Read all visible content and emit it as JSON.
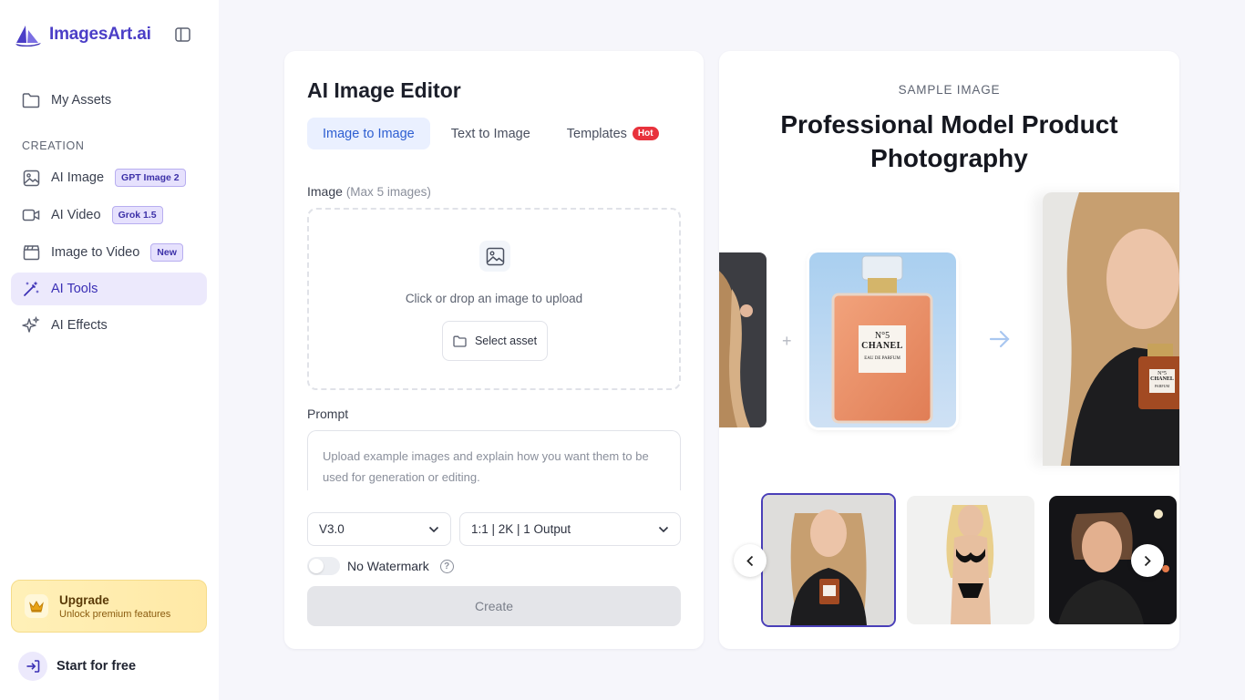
{
  "brand": {
    "name": "ImagesArt.ai"
  },
  "sidebar": {
    "my_assets": "My Assets",
    "section_label": "CREATION",
    "items": [
      {
        "label": "AI Image",
        "badge": "GPT Image 2"
      },
      {
        "label": "AI Video",
        "badge": "Grok 1.5"
      },
      {
        "label": "Image to Video",
        "badge": "New"
      },
      {
        "label": "AI Tools",
        "badge": ""
      },
      {
        "label": "AI Effects",
        "badge": ""
      }
    ],
    "active_item": "AI Tools",
    "upgrade": {
      "title": "Upgrade",
      "subtitle": "Unlock premium features"
    },
    "start_free": "Start for free"
  },
  "editor": {
    "title": "AI Image Editor",
    "tabs": [
      {
        "label": "Image to Image"
      },
      {
        "label": "Text to Image"
      },
      {
        "label": "Templates",
        "badge": "Hot"
      }
    ],
    "active_tab": "Image to Image",
    "image_label": "Image",
    "image_hint": "(Max 5 images)",
    "dropzone_text": "Click or drop an image to upload",
    "select_asset": "Select asset",
    "prompt_label": "Prompt",
    "prompt_placeholder": "Upload example images and explain how you want them to be used for generation or editing.",
    "model_value": "V3.0",
    "settings_value": "1:1 | 2K | 1 Output",
    "watermark_label": "No Watermark",
    "watermark_on": false,
    "help_glyph": "?",
    "create_label": "Create"
  },
  "sample": {
    "kicker": "SAMPLE IMAGE",
    "title": "Professional Model Product Photography",
    "plus_glyph": "+",
    "bottle_label": {
      "line1": "N°5",
      "line2": "CHANEL",
      "line3": "EAU DE PARFUM"
    },
    "result_label": {
      "line1": "N°5",
      "line2": "CHANEL",
      "line3": "PARFUM"
    },
    "selected_thumb": 1,
    "thumb_count": 3
  },
  "colors": {
    "brand": "#4b3ec7",
    "active_tab": "#2d5ed1",
    "hot_badge": "#e8323c",
    "upgrade_bg": "#fff0b8"
  }
}
